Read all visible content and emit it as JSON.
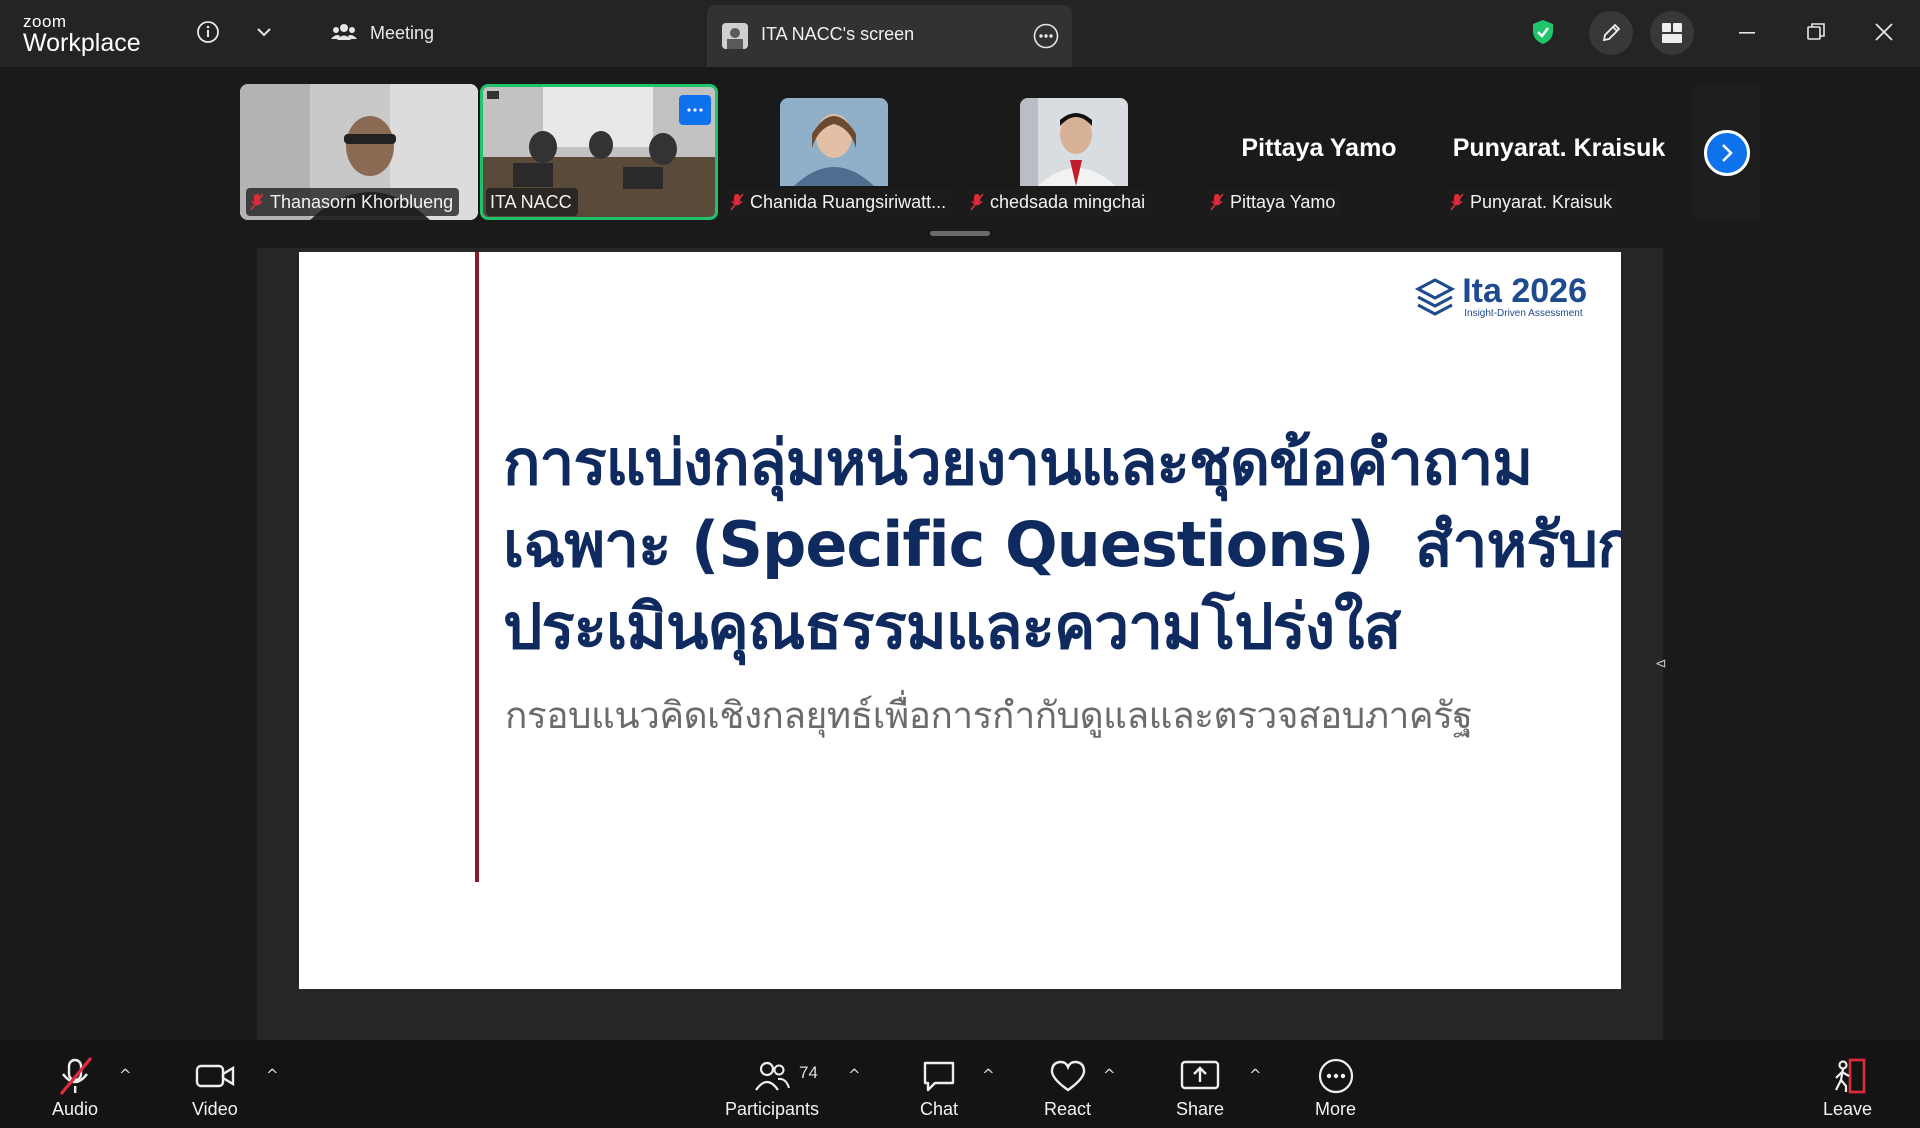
{
  "app": {
    "logo_small": "zoom",
    "logo_big": "Workplace"
  },
  "titlebar": {
    "meeting_label": "Meeting",
    "share_tab_label": "ITA NACC's screen"
  },
  "participants": [
    {
      "name": "Thanasorn Khorblueng",
      "muted": true,
      "video": true
    },
    {
      "name": "ITA NACC",
      "muted": false,
      "video": true,
      "active_speaker": true
    },
    {
      "name": "Chanida Ruangsiriwatt...",
      "muted": true,
      "avatar": true
    },
    {
      "name": "chedsada mingchai",
      "muted": true,
      "avatar": true
    },
    {
      "name": "Pittaya Yamo",
      "display_name": "Pittaya Yamo",
      "muted": true
    },
    {
      "name": "Punyarat. Kraisuk",
      "display_name": "Punyarat. Kraisuk",
      "muted": true
    }
  ],
  "slide": {
    "brand_title": "Ita 2026",
    "brand_sub": "Insight-Driven Assessment",
    "headline_1": "การแบ่งกลุ่มหน่วยงานและชุดข้อคำถาม",
    "headline_2": "เฉพาะ (Specific Questions)  สำหรับการ",
    "headline_3": "ประเมินคุณธรรมและความโปร่งใส",
    "subtitle": "กรอบแนวคิดเชิงกลยุทธ์เพื่อการกำกับดูแลและตรวจสอบภาครัฐ"
  },
  "toolbar": {
    "audio": "Audio",
    "video": "Video",
    "participants": "Participants",
    "participants_count": "74",
    "chat": "Chat",
    "react": "React",
    "share": "Share",
    "more": "More",
    "leave": "Leave"
  },
  "colors": {
    "accent_blue": "#0e72ed",
    "active_green": "#1ec36b",
    "mute_red": "#e02b3c",
    "slide_navy": "#0f2a5f",
    "slide_rule": "#8b1a2b"
  }
}
